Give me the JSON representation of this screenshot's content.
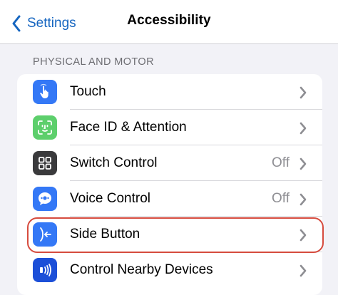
{
  "nav": {
    "back_label": "Settings",
    "title": "Accessibility"
  },
  "section": {
    "header": "PHYSICAL AND MOTOR"
  },
  "rows": [
    {
      "label": "Touch",
      "value": "",
      "icon": "hand-point-icon",
      "icon_color": "#3478f6"
    },
    {
      "label": "Face ID & Attention",
      "value": "",
      "icon": "face-id-icon",
      "icon_color": "#5dcf6c"
    },
    {
      "label": "Switch Control",
      "value": "Off",
      "icon": "switch-control-grid-icon",
      "icon_color": "#3a3a3c"
    },
    {
      "label": "Voice Control",
      "value": "Off",
      "icon": "voice-control-icon",
      "icon_color": "#3478f6"
    },
    {
      "label": "Side Button",
      "value": "",
      "icon": "side-button-icon",
      "icon_color": "#3478f6"
    },
    {
      "label": "Control Nearby Devices",
      "value": "",
      "icon": "nearby-devices-icon",
      "icon_color": "#1c4fd8"
    }
  ],
  "colors": {
    "accent": "#1565c0",
    "highlight": "#d64b3e",
    "background": "#f2f2f7"
  }
}
